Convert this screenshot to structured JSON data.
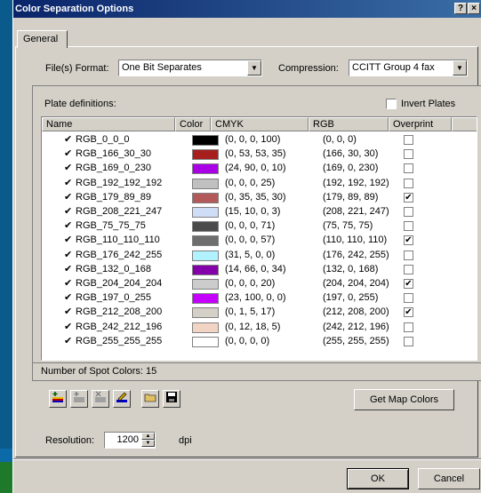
{
  "window": {
    "title": "Color Separation Options",
    "help_label": "?",
    "close_label": "×"
  },
  "tabs": [
    {
      "label": "General"
    }
  ],
  "format": {
    "label": "File(s) Format:",
    "value": "One Bit Separates"
  },
  "compression": {
    "label": "Compression:",
    "value": "CCITT Group 4 fax"
  },
  "plates": {
    "label": "Plate definitions:",
    "invert_label": "Invert Plates",
    "invert_checked": false,
    "columns": [
      "Name",
      "Color",
      "CMYK",
      "RGB",
      "Overprint"
    ],
    "rows": [
      {
        "name": "RGB_0_0_0",
        "checked": "✔",
        "color": "#000000",
        "cmyk": "(0, 0, 0, 100)",
        "rgb": "(0, 0, 0)",
        "overprint": ""
      },
      {
        "name": "RGB_166_30_30",
        "checked": "✔",
        "color": "#a61e1e",
        "cmyk": "(0, 53, 53, 35)",
        "rgb": "(166, 30, 30)",
        "overprint": ""
      },
      {
        "name": "RGB_169_0_230",
        "checked": "✔",
        "color": "#a900e6",
        "cmyk": "(24, 90, 0, 10)",
        "rgb": "(169, 0, 230)",
        "overprint": ""
      },
      {
        "name": "RGB_192_192_192",
        "checked": "✔",
        "color": "#c0c0c0",
        "cmyk": "(0, 0, 0, 25)",
        "rgb": "(192, 192, 192)",
        "overprint": ""
      },
      {
        "name": "RGB_179_89_89",
        "checked": "✔",
        "color": "#b35959",
        "cmyk": "(0, 35, 35, 30)",
        "rgb": "(179, 89, 89)",
        "overprint": "✔"
      },
      {
        "name": "RGB_208_221_247",
        "checked": "✔",
        "color": "#d0ddf7",
        "cmyk": "(15, 10, 0, 3)",
        "rgb": "(208, 221, 247)",
        "overprint": ""
      },
      {
        "name": "RGB_75_75_75",
        "checked": "✔",
        "color": "#4b4b4b",
        "cmyk": "(0, 0, 0, 71)",
        "rgb": "(75, 75, 75)",
        "overprint": ""
      },
      {
        "name": "RGB_110_110_110",
        "checked": "✔",
        "color": "#6e6e6e",
        "cmyk": "(0, 0, 0, 57)",
        "rgb": "(110, 110, 110)",
        "overprint": "✔"
      },
      {
        "name": "RGB_176_242_255",
        "checked": "✔",
        "color": "#b0f2ff",
        "cmyk": "(31, 5, 0, 0)",
        "rgb": "(176, 242, 255)",
        "overprint": ""
      },
      {
        "name": "RGB_132_0_168",
        "checked": "✔",
        "color": "#8400a8",
        "cmyk": "(14, 66, 0, 34)",
        "rgb": "(132, 0, 168)",
        "overprint": ""
      },
      {
        "name": "RGB_204_204_204",
        "checked": "✔",
        "color": "#cccccc",
        "cmyk": "(0, 0, 0, 20)",
        "rgb": "(204, 204, 204)",
        "overprint": "✔"
      },
      {
        "name": "RGB_197_0_255",
        "checked": "✔",
        "color": "#c500ff",
        "cmyk": "(23, 100, 0, 0)",
        "rgb": "(197, 0, 255)",
        "overprint": ""
      },
      {
        "name": "RGB_212_208_200",
        "checked": "✔",
        "color": "#d4d0c8",
        "cmyk": "(0, 1, 5, 17)",
        "rgb": "(212, 208, 200)",
        "overprint": "✔"
      },
      {
        "name": "RGB_242_212_196",
        "checked": "✔",
        "color": "#f2d4c4",
        "cmyk": "(0, 12, 18, 5)",
        "rgb": "(242, 212, 196)",
        "overprint": ""
      },
      {
        "name": "RGB_255_255_255",
        "checked": "✔",
        "color": "#ffffff",
        "cmyk": "(0, 0, 0, 0)",
        "rgb": "(255, 255, 255)",
        "overprint": ""
      }
    ],
    "count_text": "Number of Spot Colors: 15"
  },
  "toolbar": {
    "icons": [
      "add-plate-icon",
      "add-plate-disabled-icon",
      "delete-plate-icon",
      "edit-plate-icon",
      "open-folder-icon",
      "save-disk-icon"
    ],
    "map_colors_label": "Get Map Colors"
  },
  "resolution": {
    "label": "Resolution:",
    "value": "1200",
    "unit": "dpi"
  },
  "buttons": {
    "ok": "OK",
    "cancel": "Cancel"
  }
}
